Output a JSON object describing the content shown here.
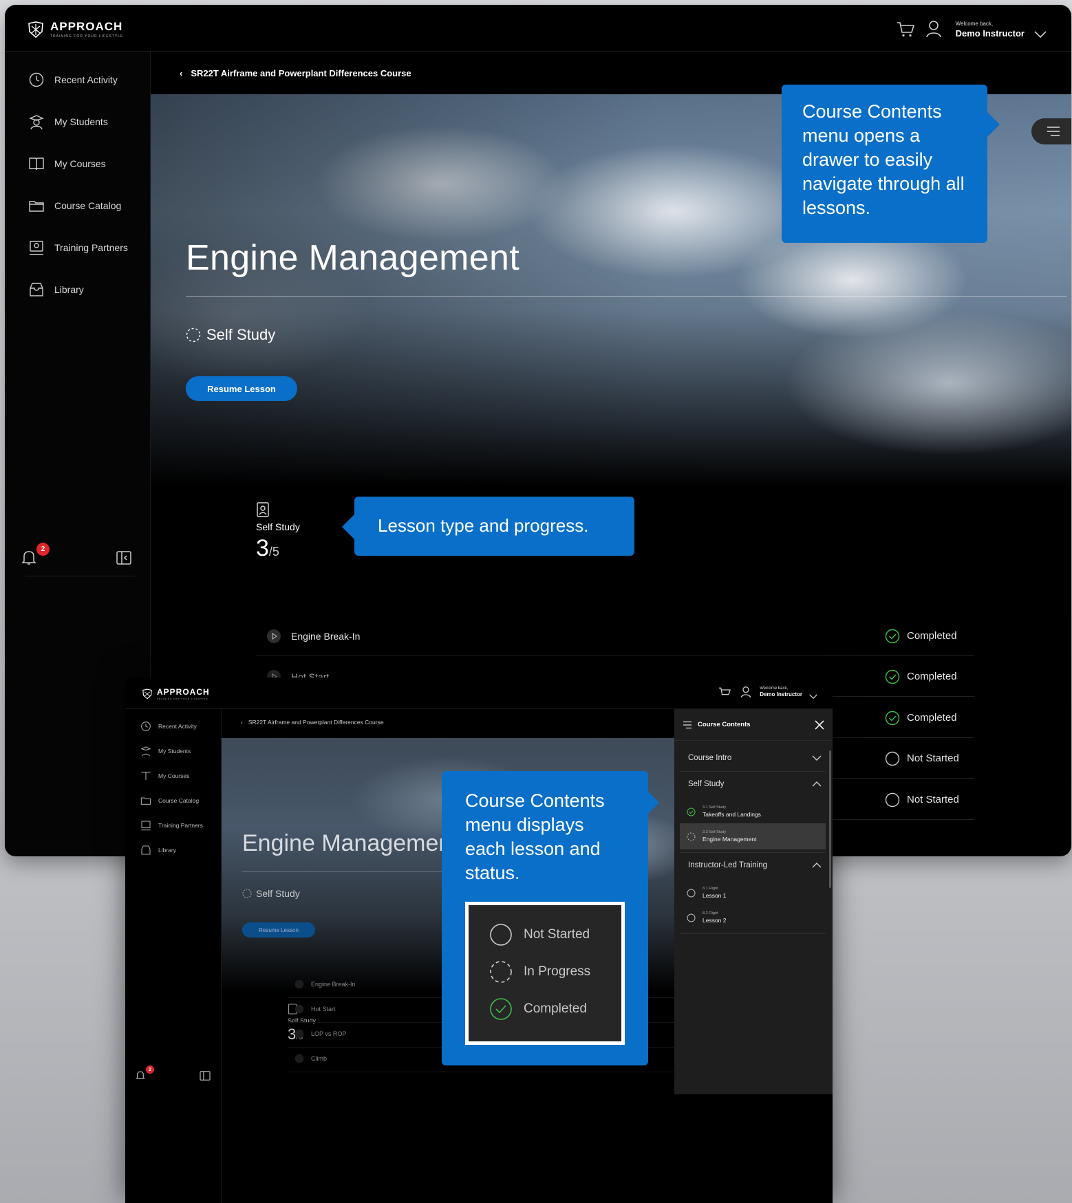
{
  "brand": {
    "name": "APPROACH",
    "tagline": "TRAINING FOR YOUR LIFESTYLE"
  },
  "header": {
    "welcome": "Welcome back,",
    "user_name": "Demo Instructor"
  },
  "sidebar": {
    "items": [
      {
        "label": "Recent Activity",
        "icon": "clock-icon"
      },
      {
        "label": "My Students",
        "icon": "pilot-icon"
      },
      {
        "label": "My Courses",
        "icon": "book-icon"
      },
      {
        "label": "Course Catalog",
        "icon": "folder-icon"
      },
      {
        "label": "Training Partners",
        "icon": "partner-icon"
      },
      {
        "label": "Library",
        "icon": "archive-icon"
      }
    ],
    "notification_count": "2"
  },
  "breadcrumb": {
    "course": "SR22T Airframe and Powerplant Differences Course"
  },
  "hero": {
    "title": "Engine Management",
    "lesson_type": "Self Study",
    "resume_label": "Resume Lesson"
  },
  "progress": {
    "label": "Self Study",
    "current": "3",
    "total": "/5",
    "fraction": 0.6
  },
  "lessons": [
    {
      "name": "Engine Break-In",
      "status": "Completed"
    },
    {
      "name": "Hot Start",
      "status": "Completed"
    },
    {
      "name": "LOP vs ROP",
      "status": "Completed"
    },
    {
      "name": "Climb",
      "status": "Not Started"
    },
    {
      "name": "",
      "status": "Not Started"
    }
  ],
  "callouts": {
    "menu": "Course Contents menu opens a drawer to easily navigate through all lessons.",
    "lesson_type": "Lesson type and progress.",
    "drawer": "Course Contents menu displays each lesson and status."
  },
  "legend": [
    {
      "label": "Not Started",
      "state": "not-started"
    },
    {
      "label": "In Progress",
      "state": "in-progress"
    },
    {
      "label": "Completed",
      "state": "completed"
    }
  ],
  "drawer": {
    "title": "Course Contents",
    "sections": [
      {
        "label": "Course Intro"
      },
      {
        "label": "Self Study"
      },
      {
        "label": "Instructor-Led Training"
      }
    ],
    "self_study_lessons": [
      {
        "kicker": "3.1 Self Study",
        "title": "Takeoffs and Landings",
        "state": "completed"
      },
      {
        "kicker": "3.3 Self Study",
        "title": "Engine Management",
        "state": "in-progress"
      }
    ],
    "instructor_lessons": [
      {
        "kicker": "8.1 Flight",
        "title": "Lesson 1",
        "state": "not-started"
      },
      {
        "kicker": "8.2 Flight",
        "title": "Lesson 2",
        "state": "not-started"
      }
    ]
  },
  "colors": {
    "accent": "#0a6fc8",
    "success": "#3fbf4a",
    "badge": "#e0262b"
  }
}
